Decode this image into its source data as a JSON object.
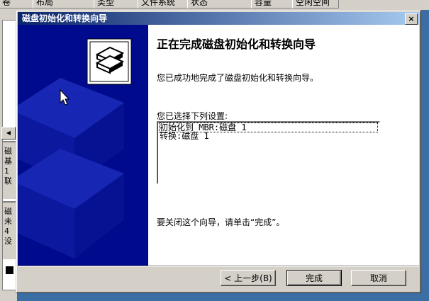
{
  "background": {
    "columns": [
      "卷",
      "布局",
      "类型",
      "文件系统",
      "状态",
      "容量",
      "空闲空间"
    ],
    "side_texts": [
      "磁",
      "基",
      "1",
      "联",
      "磁",
      "未",
      "4",
      "没"
    ]
  },
  "dialog": {
    "title": "磁盘初始化和转换向导",
    "close_label": "×",
    "heading": "正在完成磁盘初始化和转换向导",
    "success_text": "您已成功地完成了磁盘初始化和转换向导。",
    "settings_label": "您已选择下列设置:",
    "settings": [
      "初始化到 MBR:磁盘 1",
      "转换:磁盘 1"
    ],
    "closing_text": "要关闭这个向导，请单击“完成”。",
    "buttons": {
      "back": "< 上一步(B)",
      "finish": "完成",
      "cancel": "取消"
    }
  }
}
